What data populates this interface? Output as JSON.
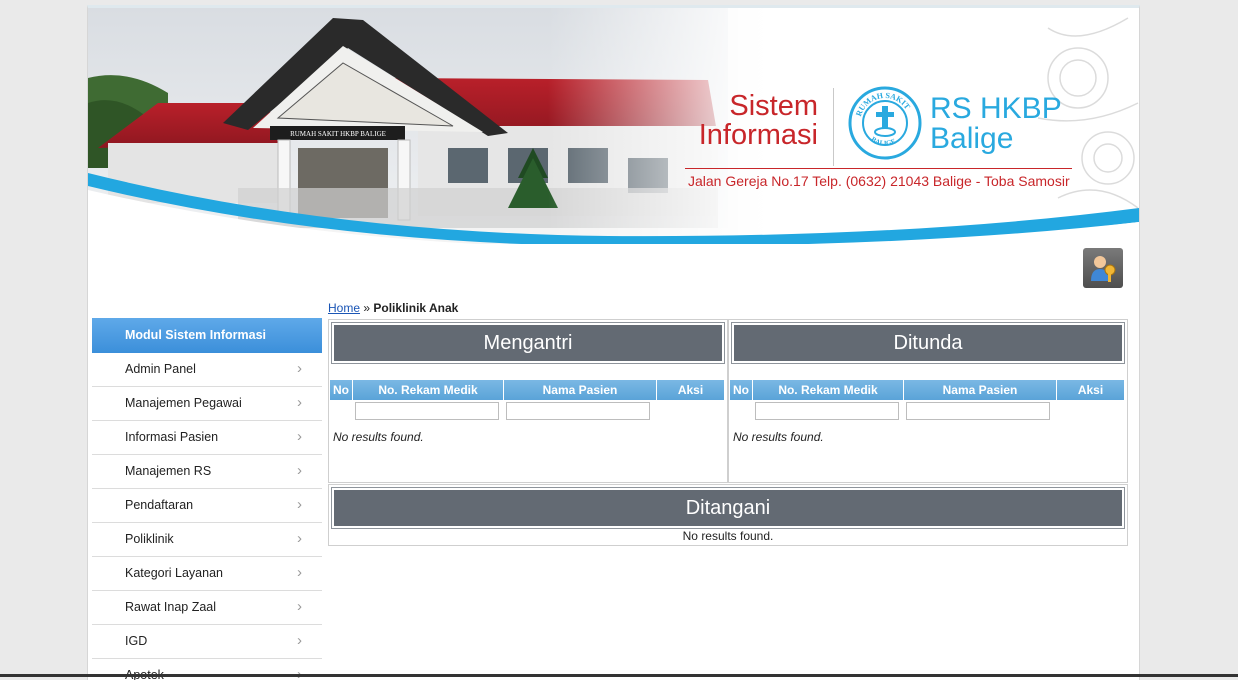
{
  "header": {
    "brand_left_line1": "Sistem",
    "brand_left_line2": "Informasi",
    "brand_right_line1": "RS HKBP",
    "brand_right_line2": "Balige",
    "address": "Jalan Gereja No.17 Telp. (0632) 21043 Balige - Toba Samosir",
    "seal_text_top": "RUMAH SAKIT",
    "seal_text_bottom": "BALIGE",
    "building_sign": "RUMAH SAKIT HKBP BALIGE"
  },
  "breadcrumb": {
    "home": "Home",
    "separator": "»",
    "current": "Poliklinik Anak"
  },
  "sidebar": {
    "heading": "Modul Sistem Informasi",
    "items": [
      {
        "label": "Admin Panel"
      },
      {
        "label": "Manajemen Pegawai"
      },
      {
        "label": "Informasi Pasien"
      },
      {
        "label": "Manajemen RS"
      },
      {
        "label": "Pendaftaran"
      },
      {
        "label": "Poliklinik"
      },
      {
        "label": "Kategori Layanan"
      },
      {
        "label": "Rawat Inap Zaal"
      },
      {
        "label": "IGD"
      },
      {
        "label": "Apotek"
      }
    ],
    "chevron": "›"
  },
  "panels": {
    "mengantri": {
      "title": "Mengantri",
      "columns": [
        "No",
        "No. Rekam Medik",
        "Nama Pasien",
        "Aksi"
      ],
      "empty": "No results found."
    },
    "ditunda": {
      "title": "Ditunda",
      "columns": [
        "No",
        "No. Rekam Medik",
        "Nama Pasien",
        "Aksi"
      ],
      "empty": "No results found."
    },
    "ditangani": {
      "title": "Ditangani",
      "empty": "No results found."
    }
  },
  "colors": {
    "brand_red": "#c8262a",
    "brand_blue": "#29a9df",
    "panel_title_bg": "#636a73",
    "table_header": "#5aa3d8",
    "sidebar_active": "#3b8fda"
  }
}
